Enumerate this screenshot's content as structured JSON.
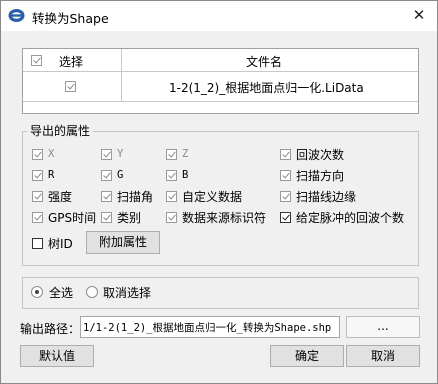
{
  "window": {
    "title": "转换为Shape",
    "close_glyph": "✕"
  },
  "file_table": {
    "col_select": "选择",
    "col_filename": "文件名",
    "rows": [
      {
        "checked": true,
        "filename": "1-2(1_2)_根据地面点归一化.LiData"
      }
    ]
  },
  "attributes": {
    "title": "导出的属性",
    "items": [
      {
        "label": "X",
        "checked": true,
        "enabled": false
      },
      {
        "label": "Y",
        "checked": true,
        "enabled": false
      },
      {
        "label": "Z",
        "checked": true,
        "enabled": false
      },
      {
        "label": "回波次数",
        "checked": true,
        "enabled": true
      },
      {
        "label": "R",
        "checked": true,
        "enabled": true
      },
      {
        "label": "G",
        "checked": true,
        "enabled": true
      },
      {
        "label": "B",
        "checked": true,
        "enabled": true
      },
      {
        "label": "扫描方向",
        "checked": true,
        "enabled": true
      },
      {
        "label": "强度",
        "checked": true,
        "enabled": true
      },
      {
        "label": "扫描角",
        "checked": true,
        "enabled": true
      },
      {
        "label": "自定义数据",
        "checked": true,
        "enabled": true
      },
      {
        "label": "扫描线边缘",
        "checked": true,
        "enabled": true
      },
      {
        "label": "GPS时间",
        "checked": true,
        "enabled": true
      },
      {
        "label": "类别",
        "checked": true,
        "enabled": true
      },
      {
        "label": "数据来源标识符",
        "checked": true,
        "enabled": true
      },
      {
        "label": "给定脉冲的回波个数",
        "checked": true,
        "enabled": true
      },
      {
        "label": "树ID",
        "checked": false,
        "enabled": true
      }
    ],
    "extra_button": "附加属性"
  },
  "selection": {
    "select_all": "全选",
    "deselect": "取消选择",
    "selected": "select_all"
  },
  "output": {
    "label": "输出路径：",
    "value": "1/1-2(1_2)_根据地面点归一化_转换为Shape.shp",
    "browse": "..."
  },
  "footer": {
    "defaults": "默认值",
    "ok": "确定",
    "cancel": "取消"
  }
}
